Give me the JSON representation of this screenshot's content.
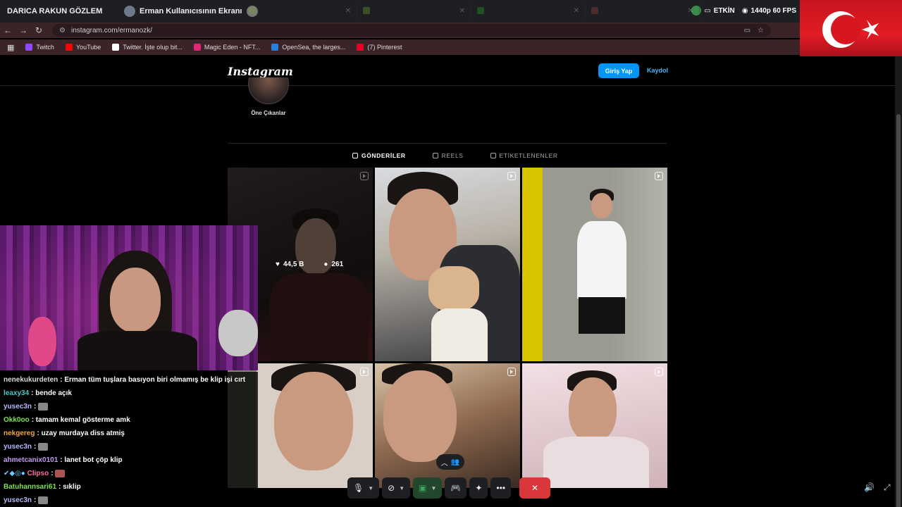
{
  "discord": {
    "server_name": "DARICA RAKUN GÖZLEM",
    "share_title": "Erman Kullanıcısının Ekranı",
    "live_badge": "ETKİN",
    "quality": "1440p 60 FPS"
  },
  "browser": {
    "url": "instagram.com/ermanozk/",
    "bookmarks": [
      {
        "label": "Twitch",
        "color": "#9146ff"
      },
      {
        "label": "YouTube",
        "color": "#ff0000"
      },
      {
        "label": "Twitter. İşte olup bit...",
        "color": "#ffffff"
      },
      {
        "label": "Magic Eden - NFT...",
        "color": "#e42575"
      },
      {
        "label": "OpenSea, the larges...",
        "color": "#2081e2"
      },
      {
        "label": "(7) Pinterest",
        "color": "#e60023"
      }
    ]
  },
  "instagram": {
    "logo": "Instagram",
    "login_label": "Giriş Yap",
    "signup_label": "Kaydol",
    "highlight_label": "Öne Çıkanlar",
    "tabs": [
      "GÖNDERİLER",
      "REELS",
      "ETİKETLENENLER"
    ],
    "hover_likes": "44,5 B",
    "hover_comments": "261"
  },
  "chat": [
    {
      "user": "nenekukurdeten",
      "color": "#d8d8d8",
      "text": ": Erman tüm tuşlara basıyon biri olmamış be klip işi cırt"
    },
    {
      "user": "leaxy34",
      "color": "#4fc7c7",
      "text": ": bende açık"
    },
    {
      "user": "yusec3n",
      "color": "#b9b9ff",
      "text": ":"
    },
    {
      "user": "Okk0oo",
      "color": "#7fe04f",
      "text": ": tamam kemal gösterme amk"
    },
    {
      "user": "nekgereg",
      "color": "#f2a83b",
      "text": ": uzay murdaya diss atmiş"
    },
    {
      "user": "yusec3n",
      "color": "#b9b9ff",
      "text": ":"
    },
    {
      "user": "ahmetcanix0101",
      "color": "#c29bf0",
      "text": ": lanet bot çöp klip"
    },
    {
      "user": "Clipso",
      "color": "#ff6fa0",
      "text": ":"
    },
    {
      "user": "Batuhannsari61",
      "color": "#7fe04f",
      "text": ": sıklip"
    },
    {
      "user": "yusec3n",
      "color": "#b9b9ff",
      "text": ":"
    }
  ]
}
